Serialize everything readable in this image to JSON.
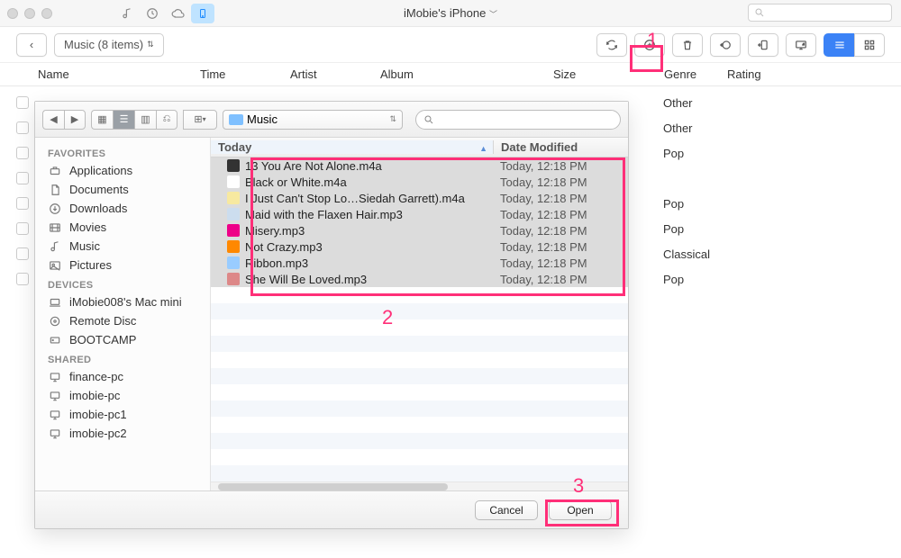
{
  "window": {
    "title": "iMobie's iPhone"
  },
  "toolbar": {
    "back_label": "‹",
    "breadcrumb": "Music (8 items)"
  },
  "columns": {
    "name": "Name",
    "time": "Time",
    "artist": "Artist",
    "album": "Album",
    "size": "Size",
    "genre": "Genre",
    "rating": "Rating"
  },
  "bg_rows": [
    {
      "genre": "Other"
    },
    {
      "genre": "Other"
    },
    {
      "genre": "Pop"
    },
    {
      "genre": ""
    },
    {
      "genre": "Pop"
    },
    {
      "genre": "Pop"
    },
    {
      "genre": "Classical"
    },
    {
      "genre": "Pop"
    }
  ],
  "annotations": {
    "one": "1",
    "two": "2",
    "three": "3"
  },
  "dialog": {
    "folder_label": "Music",
    "col_today": "Today",
    "col_date": "Date Modified",
    "favorites_h": "FAVORITES",
    "devices_h": "DEVICES",
    "shared_h": "SHARED",
    "favorites": [
      {
        "icon": "app",
        "label": "Applications"
      },
      {
        "icon": "doc",
        "label": "Documents"
      },
      {
        "icon": "dl",
        "label": "Downloads"
      },
      {
        "icon": "mov",
        "label": "Movies"
      },
      {
        "icon": "mus",
        "label": "Music"
      },
      {
        "icon": "pic",
        "label": "Pictures"
      }
    ],
    "devices": [
      {
        "icon": "mac",
        "label": "iMobie008's Mac mini"
      },
      {
        "icon": "disc",
        "label": "Remote Disc"
      },
      {
        "icon": "hd",
        "label": "BOOTCAMP"
      }
    ],
    "shared": [
      {
        "icon": "pc",
        "label": "finance-pc"
      },
      {
        "icon": "pc",
        "label": "imobie-pc"
      },
      {
        "icon": "pc",
        "label": "imobie-pc1"
      },
      {
        "icon": "pc",
        "label": "imobie-pc2"
      }
    ],
    "files": [
      {
        "name": "13 You Are Not Alone.m4a",
        "date": "Today, 12:18 PM"
      },
      {
        "name": "Black or White.m4a",
        "date": "Today, 12:18 PM"
      },
      {
        "name": "I Just Can't Stop Lo…Siedah Garrett).m4a",
        "date": "Today, 12:18 PM"
      },
      {
        "name": "Maid with the Flaxen Hair.mp3",
        "date": "Today, 12:18 PM"
      },
      {
        "name": "Misery.mp3",
        "date": "Today, 12:18 PM"
      },
      {
        "name": "Not Crazy.mp3",
        "date": "Today, 12:18 PM"
      },
      {
        "name": "Ribbon.mp3",
        "date": "Today, 12:18 PM"
      },
      {
        "name": "She Will Be Loved.mp3",
        "date": "Today, 12:18 PM"
      }
    ],
    "cancel": "Cancel",
    "open": "Open"
  }
}
